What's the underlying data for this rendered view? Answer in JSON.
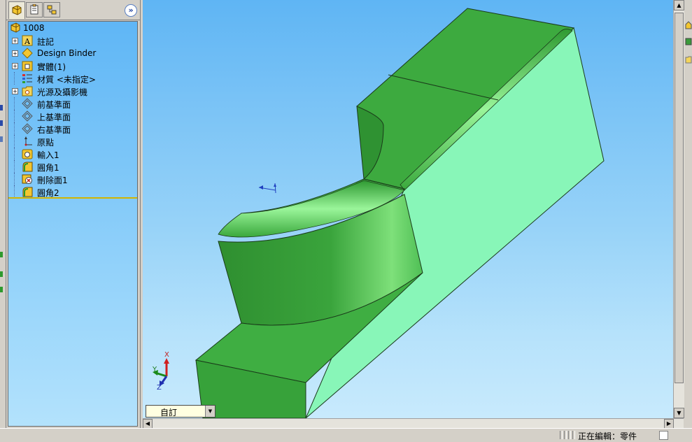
{
  "feature_tree": {
    "root": "1008",
    "items": [
      {
        "label": "註記",
        "icon": "annotations-icon",
        "expandable": true
      },
      {
        "label": "Design Binder",
        "icon": "design-binder-icon",
        "expandable": true
      },
      {
        "label": "實體(1)",
        "icon": "solid-bodies-icon",
        "expandable": true
      },
      {
        "label": "材質 <未指定>",
        "icon": "material-icon",
        "expandable": false
      },
      {
        "label": "光源及攝影機",
        "icon": "lights-cameras-icon",
        "expandable": true
      },
      {
        "label": "前基準面",
        "icon": "plane-icon",
        "expandable": false
      },
      {
        "label": "上基準面",
        "icon": "plane-icon",
        "expandable": false
      },
      {
        "label": "右基準面",
        "icon": "plane-icon",
        "expandable": false
      },
      {
        "label": "原點",
        "icon": "origin-icon",
        "expandable": false
      },
      {
        "label": "輸入1",
        "icon": "imported-body-icon",
        "expandable": false
      },
      {
        "label": "圓角1",
        "icon": "fillet-icon",
        "expandable": false
      },
      {
        "label": "刪除面1",
        "icon": "delete-face-icon",
        "expandable": false
      },
      {
        "label": "圓角2",
        "icon": "fillet-icon",
        "expandable": false
      }
    ],
    "expand_glyph": "»"
  },
  "viewport": {
    "view_orientation": "自訂",
    "triad": {
      "x": "X",
      "y": "Y",
      "z": "Z"
    }
  },
  "statusbar": {
    "text": "正在編輯：零件"
  },
  "colors": {
    "part_dark": "#38a33a",
    "part_light": "#87f5b5",
    "viewport_top": "#5fb5f4",
    "viewport_bottom": "#c8eafd"
  }
}
